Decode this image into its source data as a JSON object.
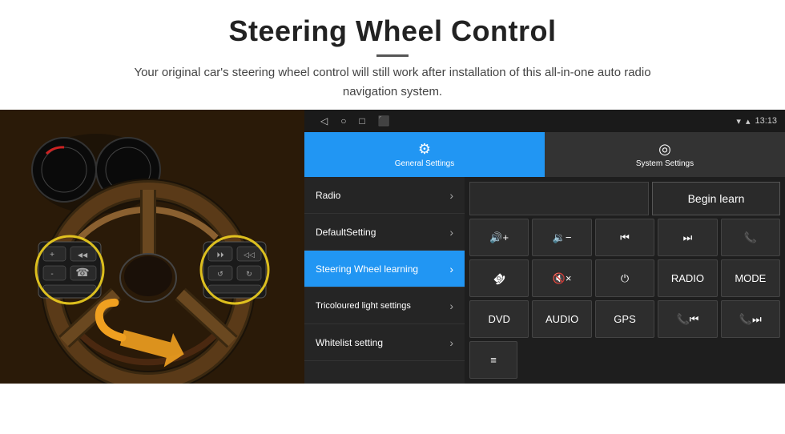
{
  "header": {
    "title": "Steering Wheel Control",
    "divider": true,
    "description": "Your original car's steering wheel control will still work after installation of this all-in-one auto radio navigation system."
  },
  "status_bar": {
    "nav_icons": [
      "◁",
      "○",
      "□",
      "⬛"
    ],
    "wifi_icon": "▾",
    "signal_icon": "▴",
    "time": "13:13"
  },
  "tabs": [
    {
      "id": "general",
      "icon": "⚙",
      "label": "General Settings",
      "active": true
    },
    {
      "id": "system",
      "icon": "◎",
      "label": "System Settings",
      "active": false
    }
  ],
  "menu_items": [
    {
      "id": "radio",
      "label": "Radio",
      "active": false
    },
    {
      "id": "default",
      "label": "DefaultSetting",
      "active": false
    },
    {
      "id": "steering",
      "label": "Steering Wheel learning",
      "active": true
    },
    {
      "id": "tricolour",
      "label": "Tricoloured light settings",
      "active": false
    },
    {
      "id": "whitelist",
      "label": "Whitelist setting",
      "active": false
    }
  ],
  "begin_learn": {
    "label": "Begin learn"
  },
  "control_buttons": {
    "row1": [
      {
        "id": "vol-up",
        "label": "🔊+",
        "unicode": "🔊+"
      },
      {
        "id": "vol-down",
        "label": "🔉-",
        "unicode": "🔉-"
      },
      {
        "id": "prev-track",
        "label": "⏮",
        "unicode": "⏮"
      },
      {
        "id": "next-track",
        "label": "⏭",
        "unicode": "⏭"
      },
      {
        "id": "phone",
        "label": "📞",
        "unicode": "📞"
      }
    ],
    "row2": [
      {
        "id": "hang-up",
        "label": "↩",
        "unicode": "↩"
      },
      {
        "id": "mute",
        "label": "🔇x",
        "unicode": "🔇x"
      },
      {
        "id": "power",
        "label": "⏻",
        "unicode": "⏻"
      },
      {
        "id": "radio-btn",
        "label": "RADIO",
        "unicode": "RADIO"
      },
      {
        "id": "mode",
        "label": "MODE",
        "unicode": "MODE"
      }
    ],
    "row3": [
      {
        "id": "dvd",
        "label": "DVD",
        "unicode": "DVD"
      },
      {
        "id": "audio",
        "label": "AUDIO",
        "unicode": "AUDIO"
      },
      {
        "id": "gps",
        "label": "GPS",
        "unicode": "GPS"
      },
      {
        "id": "tel-prev",
        "label": "📞⏮",
        "unicode": "📞⏮"
      },
      {
        "id": "tel-next",
        "label": "📞⏭",
        "unicode": "📞⏭"
      }
    ],
    "row4": [
      {
        "id": "menu-icon",
        "label": "≡",
        "unicode": "≡"
      }
    ]
  }
}
